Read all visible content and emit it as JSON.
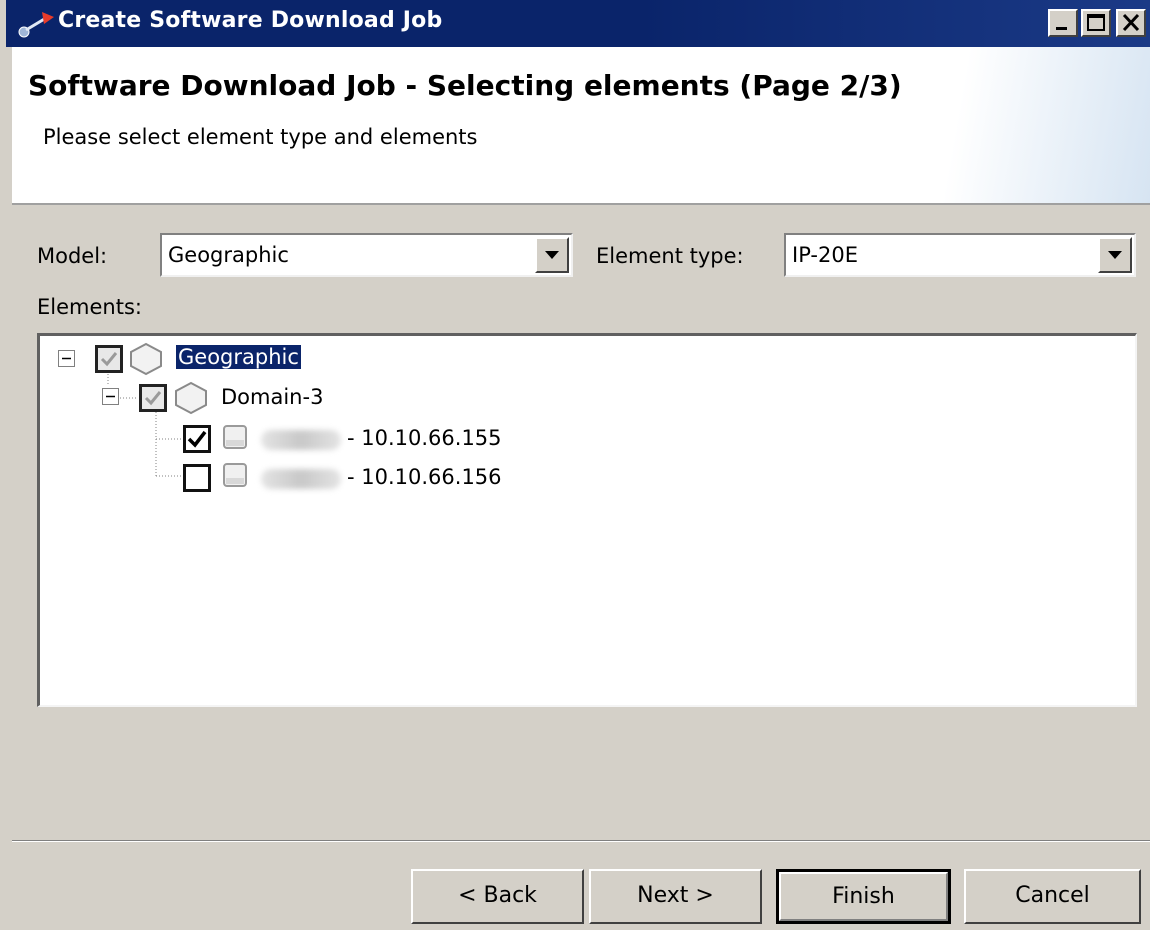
{
  "window": {
    "title": "Create Software Download Job",
    "controls": [
      "minimize-icon",
      "maximize-icon",
      "close-icon"
    ]
  },
  "header": {
    "title": "Software Download Job - Selecting elements (Page 2/3)",
    "subtitle": "Please select element type and elements"
  },
  "form": {
    "model_label": "Model:",
    "model_value": "Geographic",
    "element_type_label": "Element type:",
    "element_type_value": "IP-20E",
    "elements_label": "Elements:"
  },
  "tree": {
    "root": {
      "label": "Geographic",
      "checked": "indeterminate",
      "expanded": true,
      "icon": "hexagon-node-icon"
    },
    "domain": {
      "label": "Domain-3",
      "checked": "indeterminate",
      "expanded": true,
      "icon": "hexagon-node-icon"
    },
    "elements": [
      {
        "label": "- 10.10.66.155",
        "checked": true,
        "icon": "network-element-icon"
      },
      {
        "label": "- 10.10.66.156",
        "checked": false,
        "icon": "network-element-icon"
      }
    ]
  },
  "buttons": {
    "back": "< Back",
    "next": "Next >",
    "finish": "Finish",
    "cancel": "Cancel"
  },
  "colors": {
    "titlebar": "#0a246a",
    "selection": "#0a246a",
    "dialog_bg": "#d4d0c8"
  }
}
